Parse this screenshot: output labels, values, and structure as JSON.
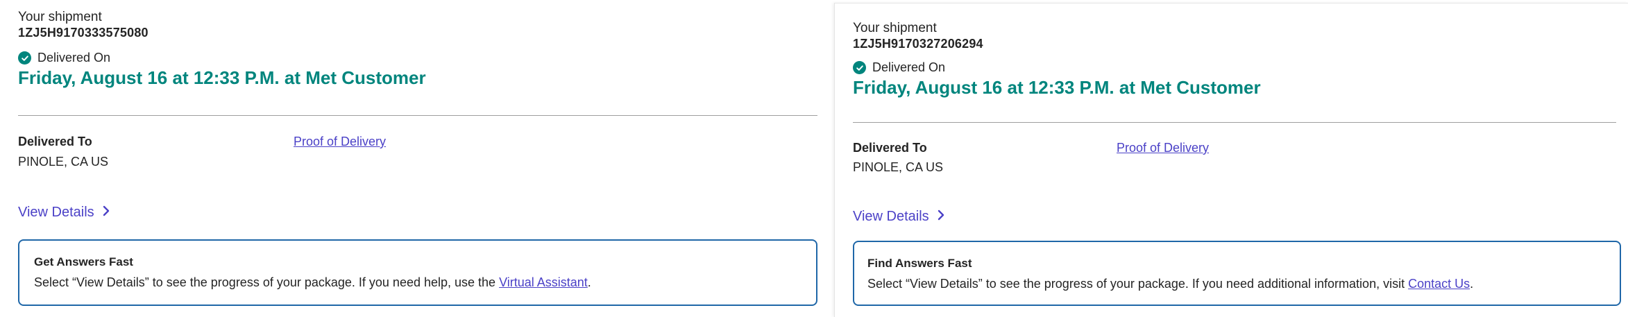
{
  "left": {
    "shipment_label": "Your shipment",
    "tracking_number": "1ZJ5H9170333575080",
    "status_label": "Delivered On",
    "delivered_date": "Friday, August 16 at 12:33 P.M. at Met Customer",
    "delivered_to_label": "Delivered To",
    "delivered_to_address": "PINOLE, CA US",
    "proof_of_delivery": "Proof of Delivery",
    "view_details": "View Details",
    "help_box": {
      "title": "Get Answers Fast",
      "text": "Select “View Details” to see the progress of your package. If you need help, use the ",
      "link": "Virtual Assistant",
      "suffix": "."
    }
  },
  "right": {
    "shipment_label": "Your shipment",
    "tracking_number": "1ZJ5H9170327206294",
    "status_label": "Delivered On",
    "delivered_date": "Friday, August 16 at 12:33 P.M. at Met Customer",
    "delivered_to_label": "Delivered To",
    "delivered_to_address": "PINOLE, CA US",
    "proof_of_delivery": "Proof of Delivery",
    "view_details": "View Details",
    "help_box": {
      "title": "Find Answers Fast",
      "text": "Select “View Details” to see the progress of your package. If you need additional information, visit ",
      "link": "Contact Us",
      "suffix": "."
    }
  },
  "colors": {
    "accent_green": "#00857d",
    "link_purple": "#4b41c7",
    "box_border_blue": "#1f67a8"
  },
  "icons": {
    "status": "check-circle-icon",
    "view_details": "chevron-right-icon"
  }
}
